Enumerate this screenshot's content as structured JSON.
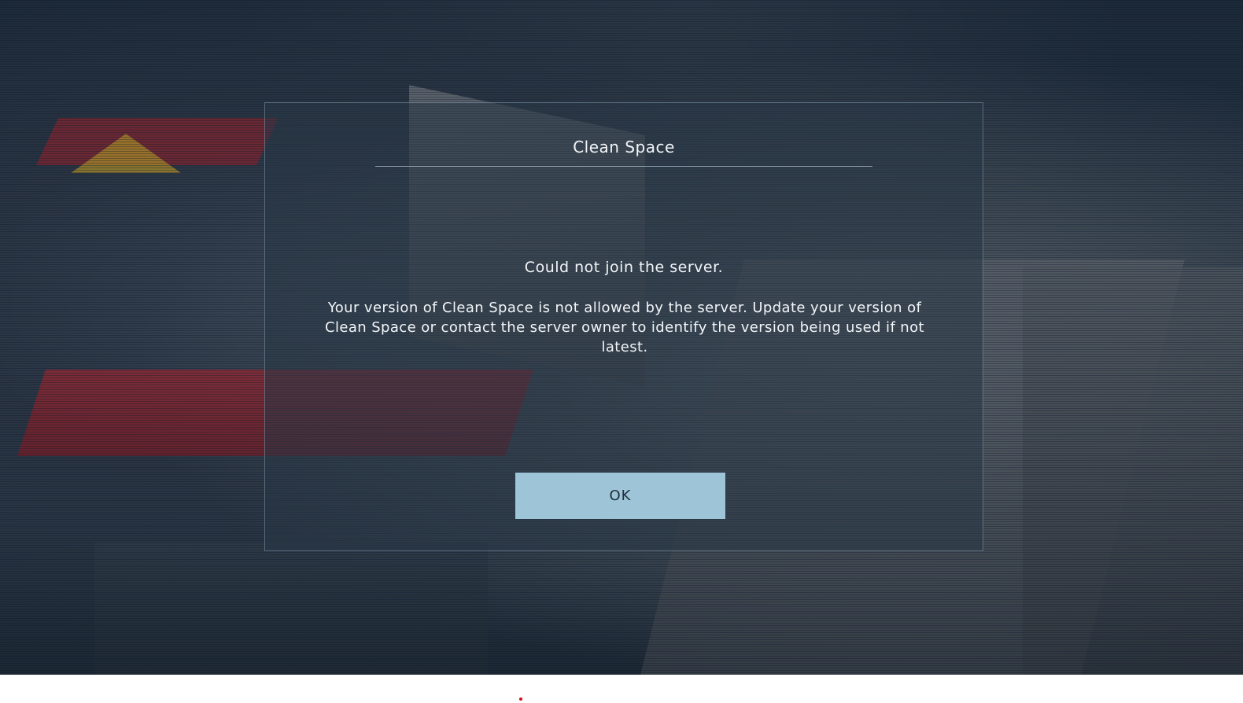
{
  "dialog": {
    "title": "Clean Space",
    "heading": "Could not join the server.",
    "body": "Your version of Clean Space is not allowed by the server. Update your version of Clean Space or contact the server owner to identify the version being used if not latest.",
    "ok_label": "OK"
  },
  "colors": {
    "button_bg": "#9ec4d8",
    "dialog_border": "#96afc3",
    "text": "#f2f5f8",
    "cursor": "#d0101a"
  }
}
